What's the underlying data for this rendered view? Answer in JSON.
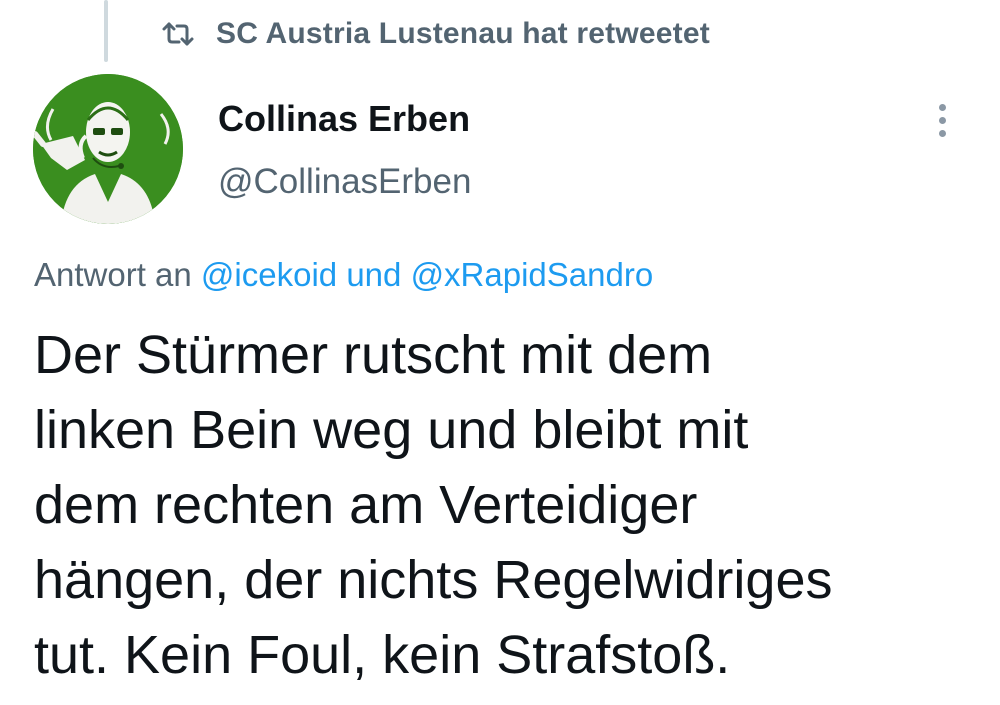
{
  "retweet": {
    "icon": "retweet-icon",
    "text": "SC Austria Lustenau hat retweetet"
  },
  "author": {
    "avatar_bg": "#3a8e1f",
    "display_name": "Collinas Erben",
    "handle": "@CollinasErben"
  },
  "more_menu": {
    "icon": "more-vertical-icon"
  },
  "reply_to": {
    "prefix": "Antwort an",
    "user1": "@icekoid",
    "connector": "und",
    "user2": "@xRapidSandro"
  },
  "tweet": {
    "lines": [
      "Der Stürmer rutscht mit dem",
      "linken Bein weg und bleibt mit",
      "dem rechten am Verteidiger",
      "hängen, der nichts Regelwidriges",
      "tut. Kein Foul, kein Strafstoß."
    ]
  },
  "colors": {
    "text": "#0f1419",
    "muted": "#536471",
    "link": "#1d9bf0",
    "thread_line": "#cfd9de"
  }
}
